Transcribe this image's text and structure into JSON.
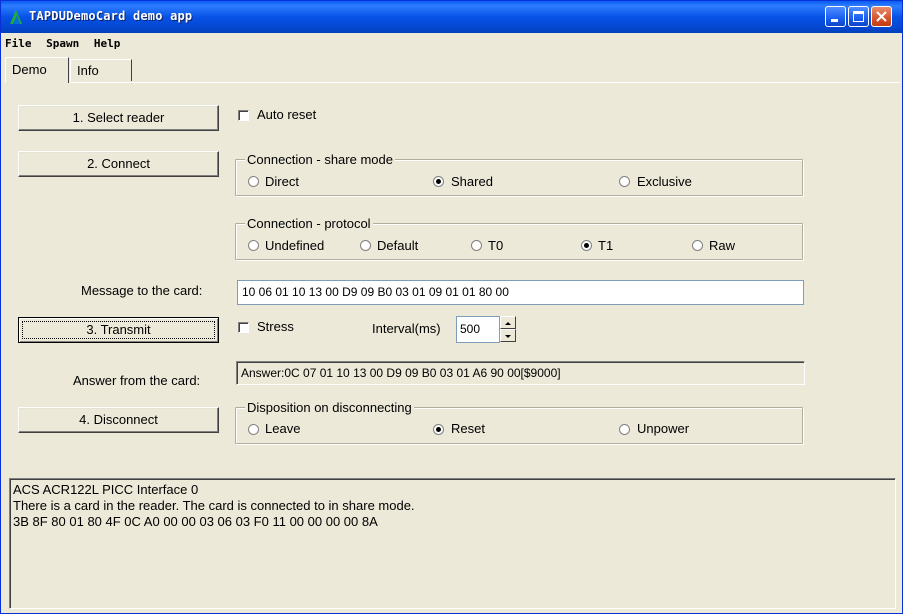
{
  "window": {
    "title": "TAPDUDemoCard demo app"
  },
  "menu": [
    "File",
    "Spawn",
    "Help"
  ],
  "tabs": [
    "Demo",
    "Info"
  ],
  "buttons": {
    "select_reader": "1. Select reader",
    "connect": "2. Connect",
    "transmit": "3. Transmit",
    "disconnect": "4. Disconnect"
  },
  "auto_reset": {
    "label": "Auto reset",
    "checked": false
  },
  "share_mode": {
    "legend": "Connection - share mode",
    "options": [
      "Direct",
      "Shared",
      "Exclusive"
    ],
    "selected": "Shared"
  },
  "protocol": {
    "legend": "Connection - protocol",
    "options": [
      "Undefined",
      "Default",
      "T0",
      "T1",
      "Raw"
    ],
    "selected": "T1"
  },
  "message": {
    "label": "Message to the card:",
    "value": "10 06 01 10 13 00 D9 09 B0 03 01 09 01 01 80 00"
  },
  "stress": {
    "label": "Stress",
    "checked": false
  },
  "interval": {
    "label": "Interval(ms)",
    "value": "500"
  },
  "answer": {
    "label": "Answer from the card:",
    "value": "Answer:0C 07 01 10 13 00 D9 09 B0 03 01 A6 90 00[$9000]"
  },
  "disposition": {
    "legend": "Disposition on disconnecting",
    "options": [
      "Leave",
      "Reset",
      "Unpower"
    ],
    "selected": "Reset"
  },
  "log": [
    "ACS ACR122L PICC Interface 0",
    "There is a card in the reader. The card is connected to in share mode.",
    "3B 8F 80 01 80 4F 0C A0 00 00 03 06 03 F0 11 00 00 00 00 8A"
  ],
  "colors": {
    "titlebar": "#0752e6",
    "face": "#ece9d8"
  }
}
